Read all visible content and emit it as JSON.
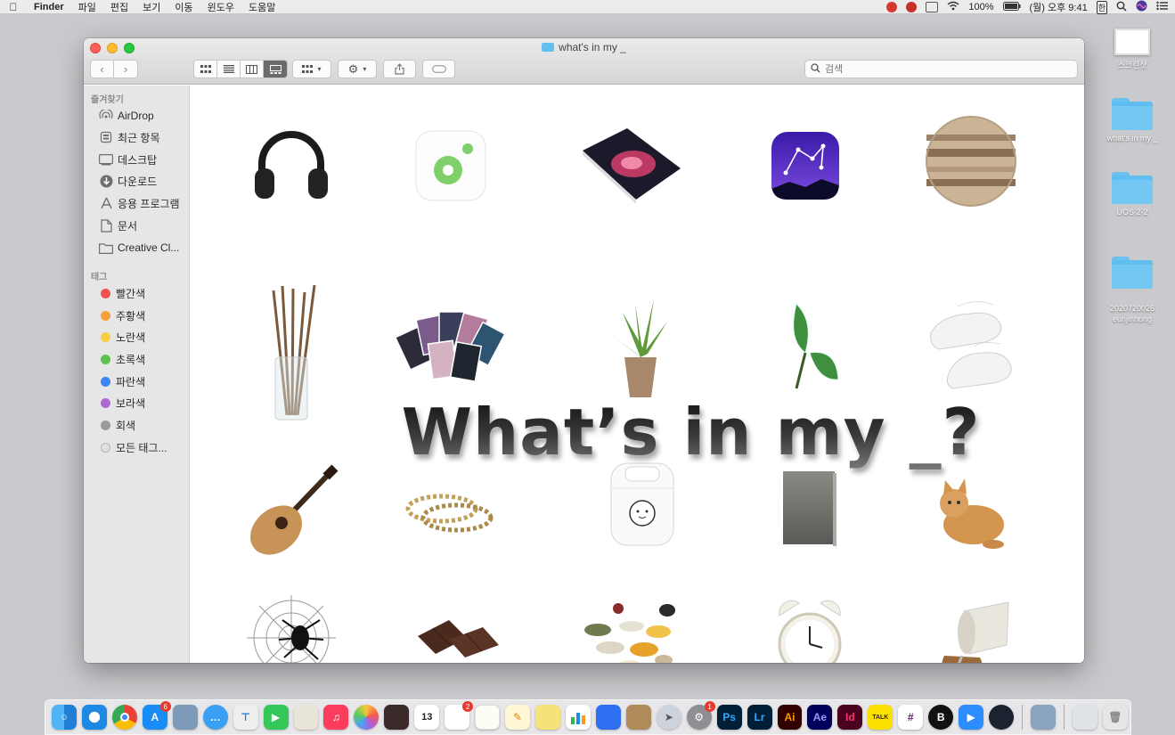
{
  "menubar": {
    "app_name": "Finder",
    "items": [
      "파일",
      "편집",
      "보기",
      "이동",
      "윈도우",
      "도움말"
    ],
    "battery": "100%",
    "clock": "(월) 오후 9:41",
    "input_lang": "한"
  },
  "desktop": {
    "items": [
      {
        "label": "스크린샷",
        "icon": "screenshot-thumbnail"
      },
      {
        "label": "what's in my _",
        "icon": "folder-icon"
      },
      {
        "label": "UOS 2-2",
        "icon": "folder-icon"
      },
      {
        "label": "2020720026\neunjinhong",
        "icon": "folder-icon"
      }
    ]
  },
  "window": {
    "title": "what's in my _",
    "search_placeholder": "검색"
  },
  "sidebar": {
    "favorites_heading": "즐겨찾기",
    "favorites": [
      {
        "label": "AirDrop",
        "icon": "airdrop-icon"
      },
      {
        "label": "최근 항목",
        "icon": "recents-icon"
      },
      {
        "label": "데스크탑",
        "icon": "desktop-icon"
      },
      {
        "label": "다운로드",
        "icon": "downloads-icon"
      },
      {
        "label": "응용 프로그램",
        "icon": "applications-icon"
      },
      {
        "label": "문서",
        "icon": "documents-icon"
      },
      {
        "label": "Creative Cl...",
        "icon": "folder-icon"
      }
    ],
    "tags_heading": "태그",
    "tags": [
      {
        "label": "빨간색",
        "color": "#f0534d"
      },
      {
        "label": "주황색",
        "color": "#f7a03a"
      },
      {
        "label": "노란색",
        "color": "#f8cd46"
      },
      {
        "label": "초록색",
        "color": "#5ac24f"
      },
      {
        "label": "파란색",
        "color": "#3b86f0"
      },
      {
        "label": "보라색",
        "color": "#b168d6"
      },
      {
        "label": "회색",
        "color": "#9a9a9a"
      },
      {
        "label": "모든 태그...",
        "color": "#e0e0e0"
      }
    ]
  },
  "content": {
    "overlay_title": "What’s in my _?",
    "items": [
      {
        "icon": "headphones-icon"
      },
      {
        "icon": "app-icon-green-dot"
      },
      {
        "icon": "space-book-icon"
      },
      {
        "icon": "star-chart-app-icon"
      },
      {
        "icon": "jupiter-icon"
      },
      {
        "icon": "paint-brushes-icon"
      },
      {
        "icon": "photo-cards-icon"
      },
      {
        "icon": "potted-plant-icon"
      },
      {
        "icon": "leaf-plant-icon"
      },
      {
        "icon": "sneakers-icon"
      },
      {
        "icon": "acoustic-guitar-icon"
      },
      {
        "icon": "bracelets-icon"
      },
      {
        "icon": "airpods-case-icon"
      },
      {
        "icon": "book-icon"
      },
      {
        "icon": "cat-icon"
      },
      {
        "icon": "spider-web-icon"
      },
      {
        "icon": "chocolate-icon"
      },
      {
        "icon": "pills-icon"
      },
      {
        "icon": "alarm-clock-icon"
      },
      {
        "icon": "spilled-cup-icon"
      }
    ]
  },
  "dock": {
    "badges": {
      "app_store": "6",
      "reminders": "2",
      "system_prefs": "1"
    },
    "calendar_day": "13",
    "labels": [
      "Ps",
      "Lr",
      "Ai",
      "Ae",
      "Id",
      "TALK"
    ]
  }
}
